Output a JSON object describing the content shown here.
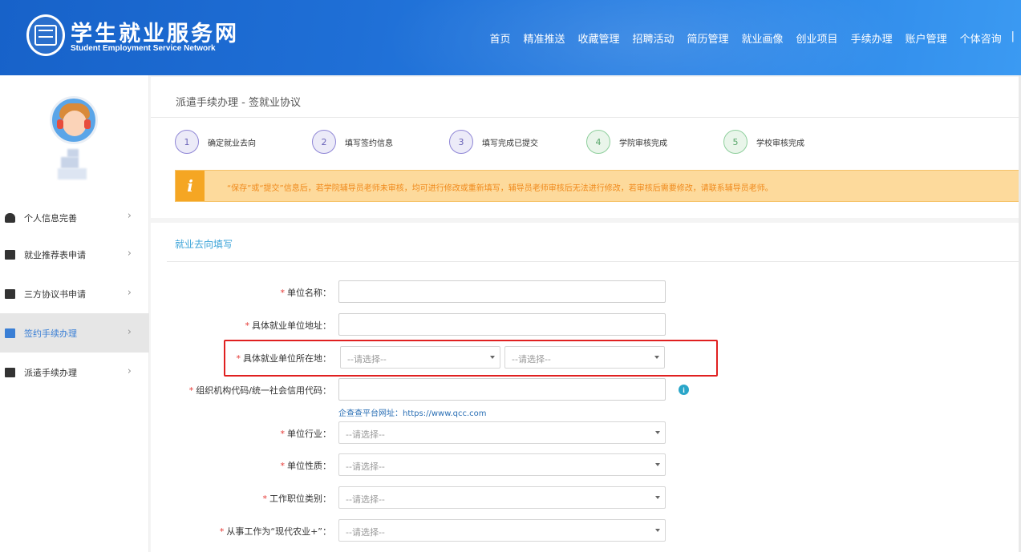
{
  "header": {
    "title": "学生就业服务网",
    "subtitle": "Student Employment Service Network",
    "nav": [
      "首页",
      "精准推送",
      "收藏管理",
      "招聘活动",
      "简历管理",
      "就业画像",
      "创业项目",
      "手续办理",
      "账户管理",
      "个体咨询"
    ],
    "nav_sep": "|"
  },
  "sidebar": {
    "items": [
      {
        "label": "个人信息完善",
        "icon": "user-icon"
      },
      {
        "label": "就业推荐表申请",
        "icon": "document-icon"
      },
      {
        "label": "三方协议书申请",
        "icon": "document-icon"
      },
      {
        "label": "签约手续办理",
        "icon": "building-icon",
        "active": true
      },
      {
        "label": "派遣手续办理",
        "icon": "id-card-icon"
      }
    ],
    "chevron": "›"
  },
  "breadcrumb": "派遣手续办理 - 签就业协议",
  "steps": [
    {
      "num": "1",
      "label": "确定就业去向"
    },
    {
      "num": "2",
      "label": "填写签约信息"
    },
    {
      "num": "3",
      "label": "填写完成已提交"
    },
    {
      "num": "4",
      "label": "学院审核完成"
    },
    {
      "num": "5",
      "label": "学校审核完成"
    }
  ],
  "notice": {
    "icon": "i",
    "text": "“保存”或“提交”信息后，若学院辅导员老师未审核，均可进行修改或重新填写，辅导员老师审核后无法进行修改，若审核后需要修改，请联系辅导员老师。"
  },
  "form": {
    "section_title": "就业去向填写",
    "required_mark": "*",
    "select_placeholder": "--请选择--",
    "fields": {
      "unit_name": "单位名称：",
      "unit_address": "具体就业单位地址：",
      "unit_location": "具体就业单位所在地：",
      "org_code": "组织机构代码/统一社会信用代码：",
      "industry": "单位行业：",
      "nature": "单位性质：",
      "job_category": "工作职位类别：",
      "modern_agri": "从事工作为“现代农业+”："
    },
    "qcc_link": "企查查平台网址：https://www.qcc.com",
    "info_icon": "i"
  },
  "colors": {
    "header_blue": "#1f6fd6",
    "accent": "#3ba3d8",
    "required": "#e53935",
    "notice_bg": "#fdda9c",
    "highlight_border": "#e02020"
  }
}
